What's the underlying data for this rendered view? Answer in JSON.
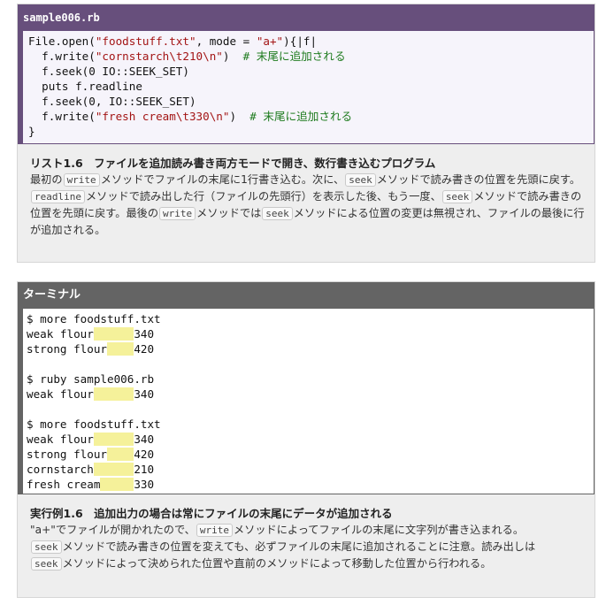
{
  "listing": {
    "filename": "sample006.rb",
    "lines": [
      "File.open(\"foodstuff.txt\", mode = \"a+\"){|f|",
      "  f.write(\"cornstarch\\t210\\n\")  # 末尾に追加される",
      "  f.seek(0 IO::SEEK_SET)",
      "  puts f.readline",
      "  f.seek(0, IO::SEEK_SET)",
      "  f.write(\"fresh cream\\t330\\n\")  # 末尾に追加される",
      "}"
    ],
    "caption_title": "リスト1.6　ファイルを追加読み書き両方モードで開き、数行書き込むプログラム",
    "caption": {
      "t1": "最初の",
      "c1": "write",
      "t2": "メソッドでファイルの末尾に1行書き込む。次に、",
      "c2": "seek",
      "t3": "メソッドで読み書きの位置を先頭に戻す。",
      "c3": "readline",
      "t4": "メソッドで読み出した行（ファイルの先頭行）を表示した後、もう一度、",
      "c4": "seek",
      "t5": "メソッドで読み書きの位置を先頭に戻す。最後の",
      "c5": "write",
      "t6": "メソッドでは",
      "c6": "seek",
      "t7": "メソッドによる位置の変更は無視され、ファイルの最後に行が追加される。"
    }
  },
  "terminal": {
    "title": "ターミナル",
    "lines": [
      {
        "a": "$ more foodstuff.txt"
      },
      {
        "a": "weak flour",
        "tab": "      ",
        "b": "340"
      },
      {
        "a": "strong flour",
        "tab": "    ",
        "b": "420"
      },
      {
        "a": ""
      },
      {
        "a": "$ ruby sample006.rb"
      },
      {
        "a": "weak flour",
        "tab": "      ",
        "b": "340"
      },
      {
        "a": ""
      },
      {
        "a": "$ more foodstuff.txt"
      },
      {
        "a": "weak flour",
        "tab": "      ",
        "b": "340"
      },
      {
        "a": "strong flour",
        "tab": "    ",
        "b": "420"
      },
      {
        "a": "cornstarch",
        "tab": "      ",
        "b": "210"
      },
      {
        "a": "fresh cream",
        "tab": "     ",
        "b": "330"
      }
    ],
    "caption_title": "実行例1.6　追加出力の場合は常にファイルの末尾にデータが追加される",
    "caption": {
      "t1": "\"a+\"でファイルが開かれたので、",
      "c1": "write",
      "t2": "メソッドによってファイルの末尾に文字列が書き込まれる。",
      "c2": "seek",
      "t3": "メソッドで読み書きの位置を変えても、必ずファイルの末尾に追加されることに注意。読み出しは",
      "c3": "seek",
      "t4": "メソッドによって決められた位置や直前のメソッドによって移動した位置から行われる。"
    }
  },
  "colors": {
    "listing_header": "#674f7c",
    "terminal_header": "#646464",
    "tab_highlight": "#f5f19a",
    "string": "#a31515",
    "comment": "#1e7b1e"
  }
}
